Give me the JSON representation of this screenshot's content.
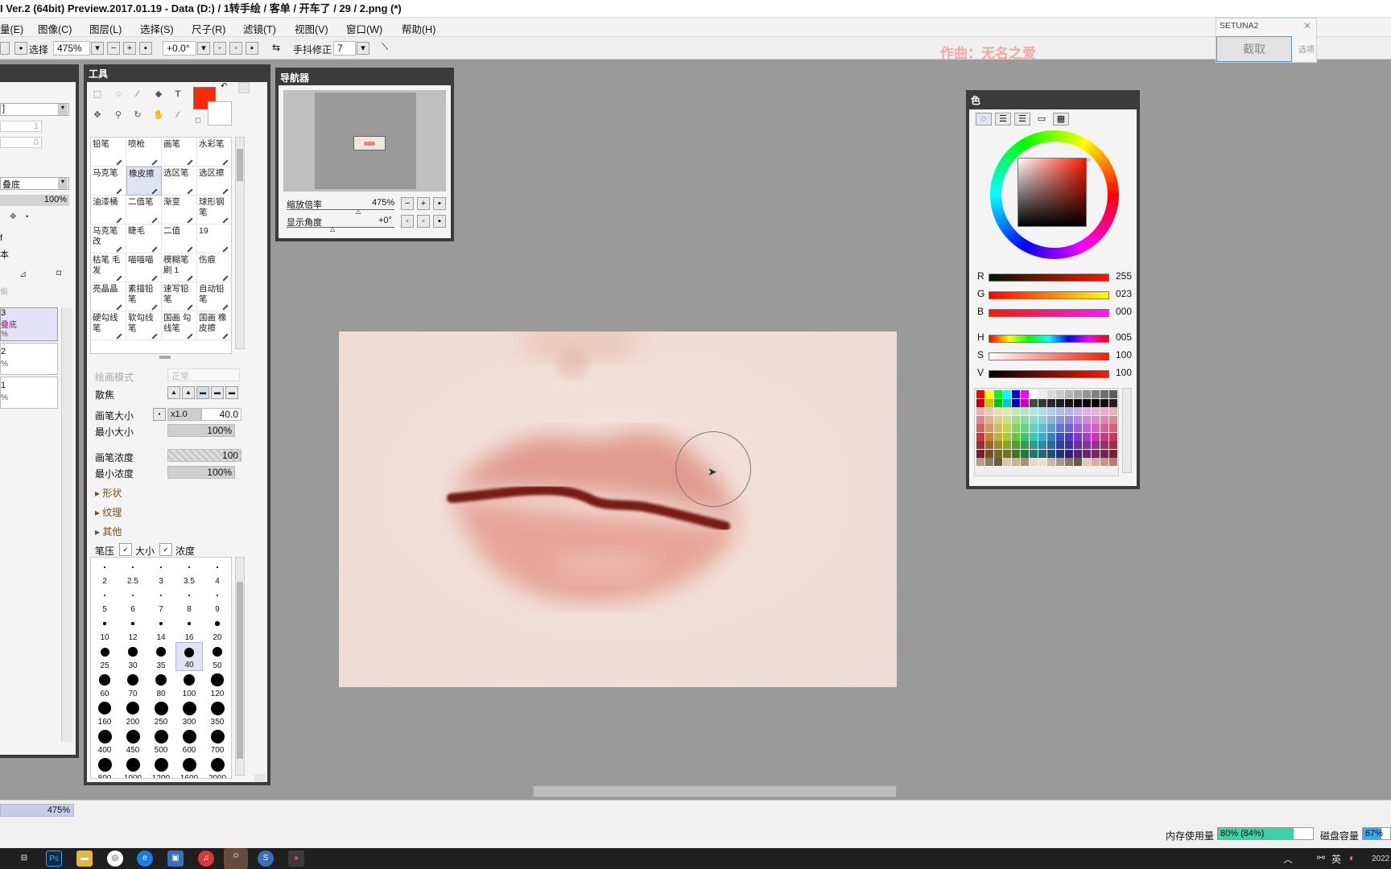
{
  "window": {
    "title": "I Ver.2 (64bit) Preview.2017.01.19 - Data (D:) / 1转手绘 / 客单 / 开车了 / 29 / 2.png (*)"
  },
  "menu": [
    "量(E)",
    "图像(C)",
    "图层(L)",
    "选择(S)",
    "尺子(R)",
    "滤镜(T)",
    "视图(V)",
    "窗口(W)",
    "帮助(H)"
  ],
  "toolbar": {
    "select_label": "选择",
    "zoom": "475%",
    "angle": "+0.0°",
    "stabilizer_label": "手抖修正",
    "stabilizer_value": "7"
  },
  "watermark": "作曲：无名之爱",
  "setuna": {
    "title": "SETUNA2",
    "capture": "截取",
    "options": "选项"
  },
  "layer_panel": {
    "dropdown": "]",
    "value1": "1",
    "value2": "0",
    "mode": "叠底",
    "opacity": "100%",
    "opt1": "f",
    "opt2": "本",
    "layers": [
      {
        "name": "3",
        "mode": "叠底",
        "opacity": "%"
      },
      {
        "name": "2",
        "opacity": "%"
      },
      {
        "name": "1",
        "opacity": "%"
      }
    ]
  },
  "tools": {
    "title": "工具",
    "primary_color": "#ff2a00",
    "brushes": [
      {
        "label": "铅笔"
      },
      {
        "label": "喷枪"
      },
      {
        "label": "画笔"
      },
      {
        "label": "水彩笔"
      },
      {
        "label": "马克笔"
      },
      {
        "label": "橡皮擦"
      },
      {
        "label": "选区笔"
      },
      {
        "label": "选区擦"
      },
      {
        "label": "油漆桶"
      },
      {
        "label": "二值笔"
      },
      {
        "label": "渐变"
      },
      {
        "label": "球形钢笔"
      },
      {
        "label": "马克笔改"
      },
      {
        "label": "睫毛"
      },
      {
        "label": "二值"
      },
      {
        "label": "19"
      },
      {
        "label": "枯笔 毛发"
      },
      {
        "label": "喵喵喵"
      },
      {
        "label": "模糊笔刷 1"
      },
      {
        "label": "伤痕"
      },
      {
        "label": "亮晶晶"
      },
      {
        "label": "素描铅笔"
      },
      {
        "label": "速写铅笔"
      },
      {
        "label": "自动铅笔"
      },
      {
        "label": "硬勾线笔"
      },
      {
        "label": "软勾线笔"
      },
      {
        "label": "国画 勾线笔"
      },
      {
        "label": "国画 橡皮擦"
      }
    ],
    "blend_mode_label": "绘画模式",
    "blend_mode_value": "正常",
    "scatter_label": "散焦",
    "brush_size_label": "画笔大小",
    "brush_size_mult": "x1.0",
    "brush_size": "40.0",
    "min_size_label": "最小大小",
    "min_size": "100%",
    "density_label": "画笔浓度",
    "density": "100",
    "min_density_label": "最小浓度",
    "min_density": "100%",
    "section_shape": "形状",
    "section_texture": "纹理",
    "section_other": "其他",
    "pressure_label": "笔压",
    "pressure_size": "大小",
    "pressure_density": "浓度",
    "sizes": [
      "2",
      "2.5",
      "3",
      "3.5",
      "4",
      "5",
      "6",
      "7",
      "8",
      "9",
      "10",
      "12",
      "14",
      "16",
      "20",
      "25",
      "30",
      "35",
      "40",
      "50",
      "60",
      "70",
      "80",
      "100",
      "120",
      "160",
      "200",
      "250",
      "300",
      "350",
      "400",
      "450",
      "500",
      "600",
      "700",
      "800",
      "1000",
      "1200",
      "1600",
      "2000"
    ],
    "selected_size": "40"
  },
  "navigator": {
    "title": "导航器",
    "zoom_label": "缩放倍率",
    "zoom_value": "475%",
    "angle_label": "显示角度",
    "angle_value": "+0°"
  },
  "color_panel": {
    "title": "色",
    "rgb": {
      "R": "255",
      "G": "023",
      "B": "000"
    },
    "hsv": {
      "H": "005",
      "S": "100",
      "V": "100"
    },
    "current": "#ff1700"
  },
  "status": {
    "zoom": "475%",
    "memory_label": "内存使用量",
    "memory_value": "80% (84%)",
    "memory_fraction": 0.8,
    "disk_label": "磁盘容量",
    "disk_value": "67%",
    "disk_fraction": 0.67
  },
  "taskbar": {
    "ime": "英",
    "clock": "2022"
  }
}
